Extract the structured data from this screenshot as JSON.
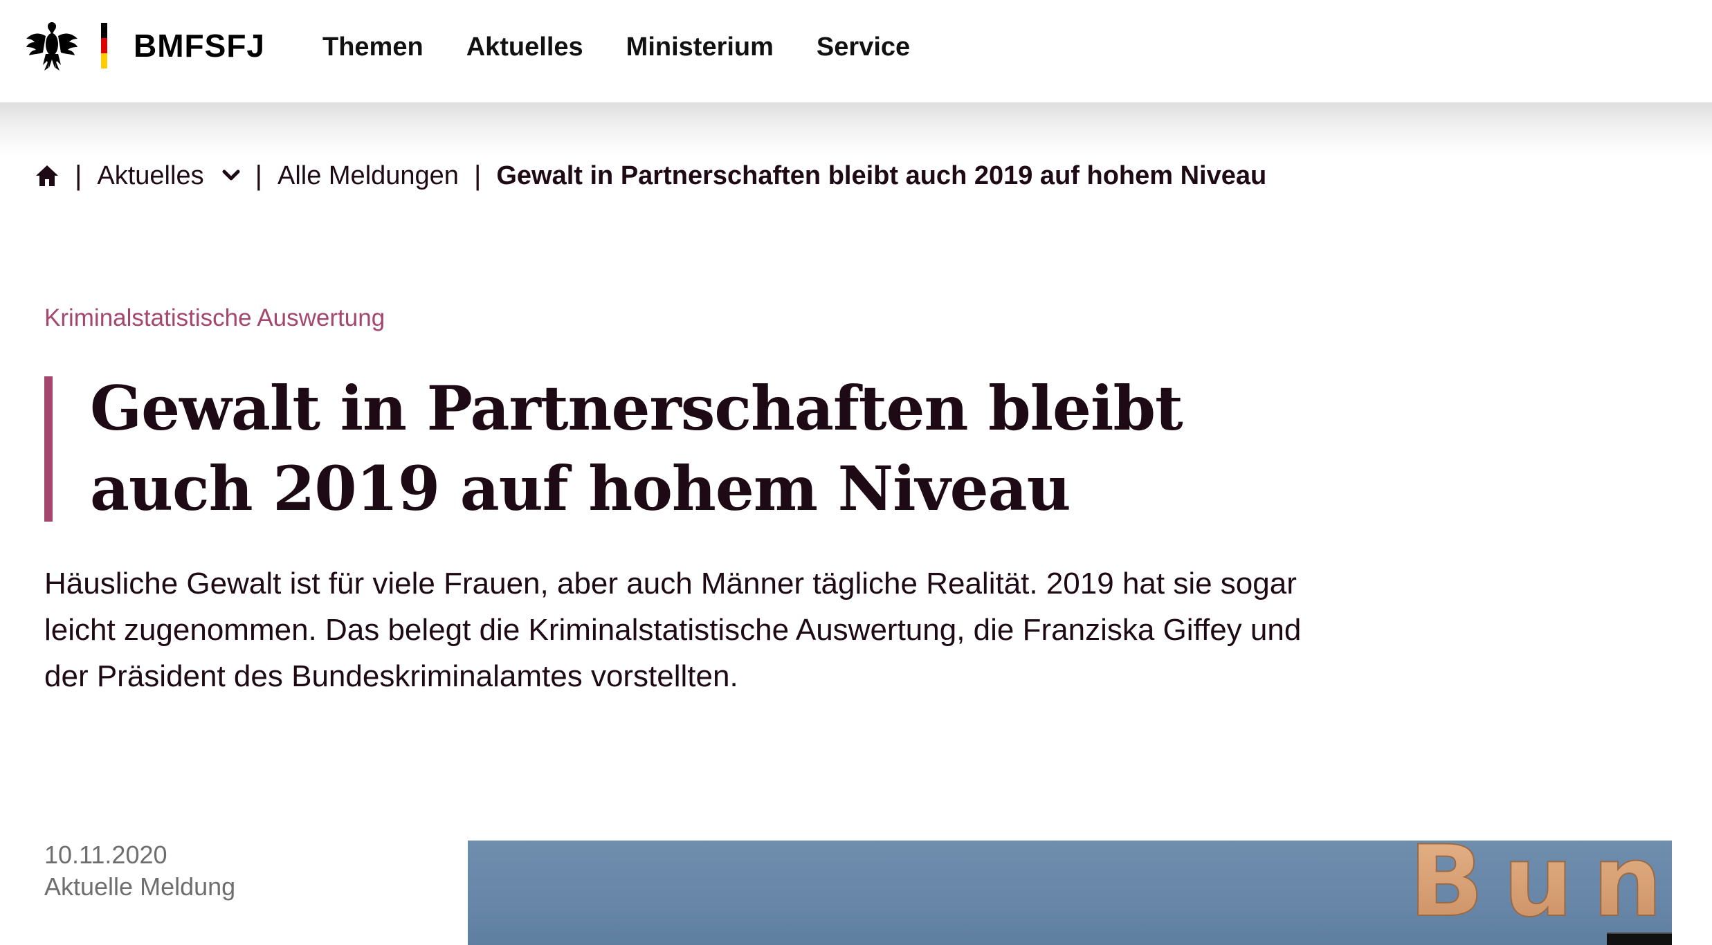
{
  "header": {
    "brand": "BMFSFJ",
    "logo_icon": "federal-eagle-icon",
    "flag_colors": [
      "#000000",
      "#dd0000",
      "#ffcc00"
    ],
    "nav": [
      {
        "label": "Themen"
      },
      {
        "label": "Aktuelles"
      },
      {
        "label": "Ministerium"
      },
      {
        "label": "Service"
      }
    ]
  },
  "breadcrumb": {
    "home_icon": "home-icon",
    "items": [
      {
        "label": "Aktuelles",
        "has_dropdown": true
      },
      {
        "label": "Alle Meldungen"
      }
    ],
    "current": "Gewalt in Partnerschaften bleibt auch 2019 auf hohem Niveau"
  },
  "article": {
    "kicker": "Kriminalstatistische Auswertung",
    "title": "Gewalt in Partnerschaften bleibt auch 2019 auf hohem Niveau",
    "lead": "Häusliche Gewalt ist für viele Frauen, aber auch Männer tägliche Realität. 2019 hat sie sogar leicht zugenommen. Das belegt die Kriminalstatistische Auswertung, die Franziska Giffey und der Präsident des Bundeskriminalamtes vorstellten.",
    "date": "10.11.2020",
    "type": "Aktuelle Meldung",
    "image_text": "Bundespress"
  },
  "colors": {
    "accent": "#a4466e",
    "text": "#1e0a14",
    "meta": "#6e6e6e"
  }
}
